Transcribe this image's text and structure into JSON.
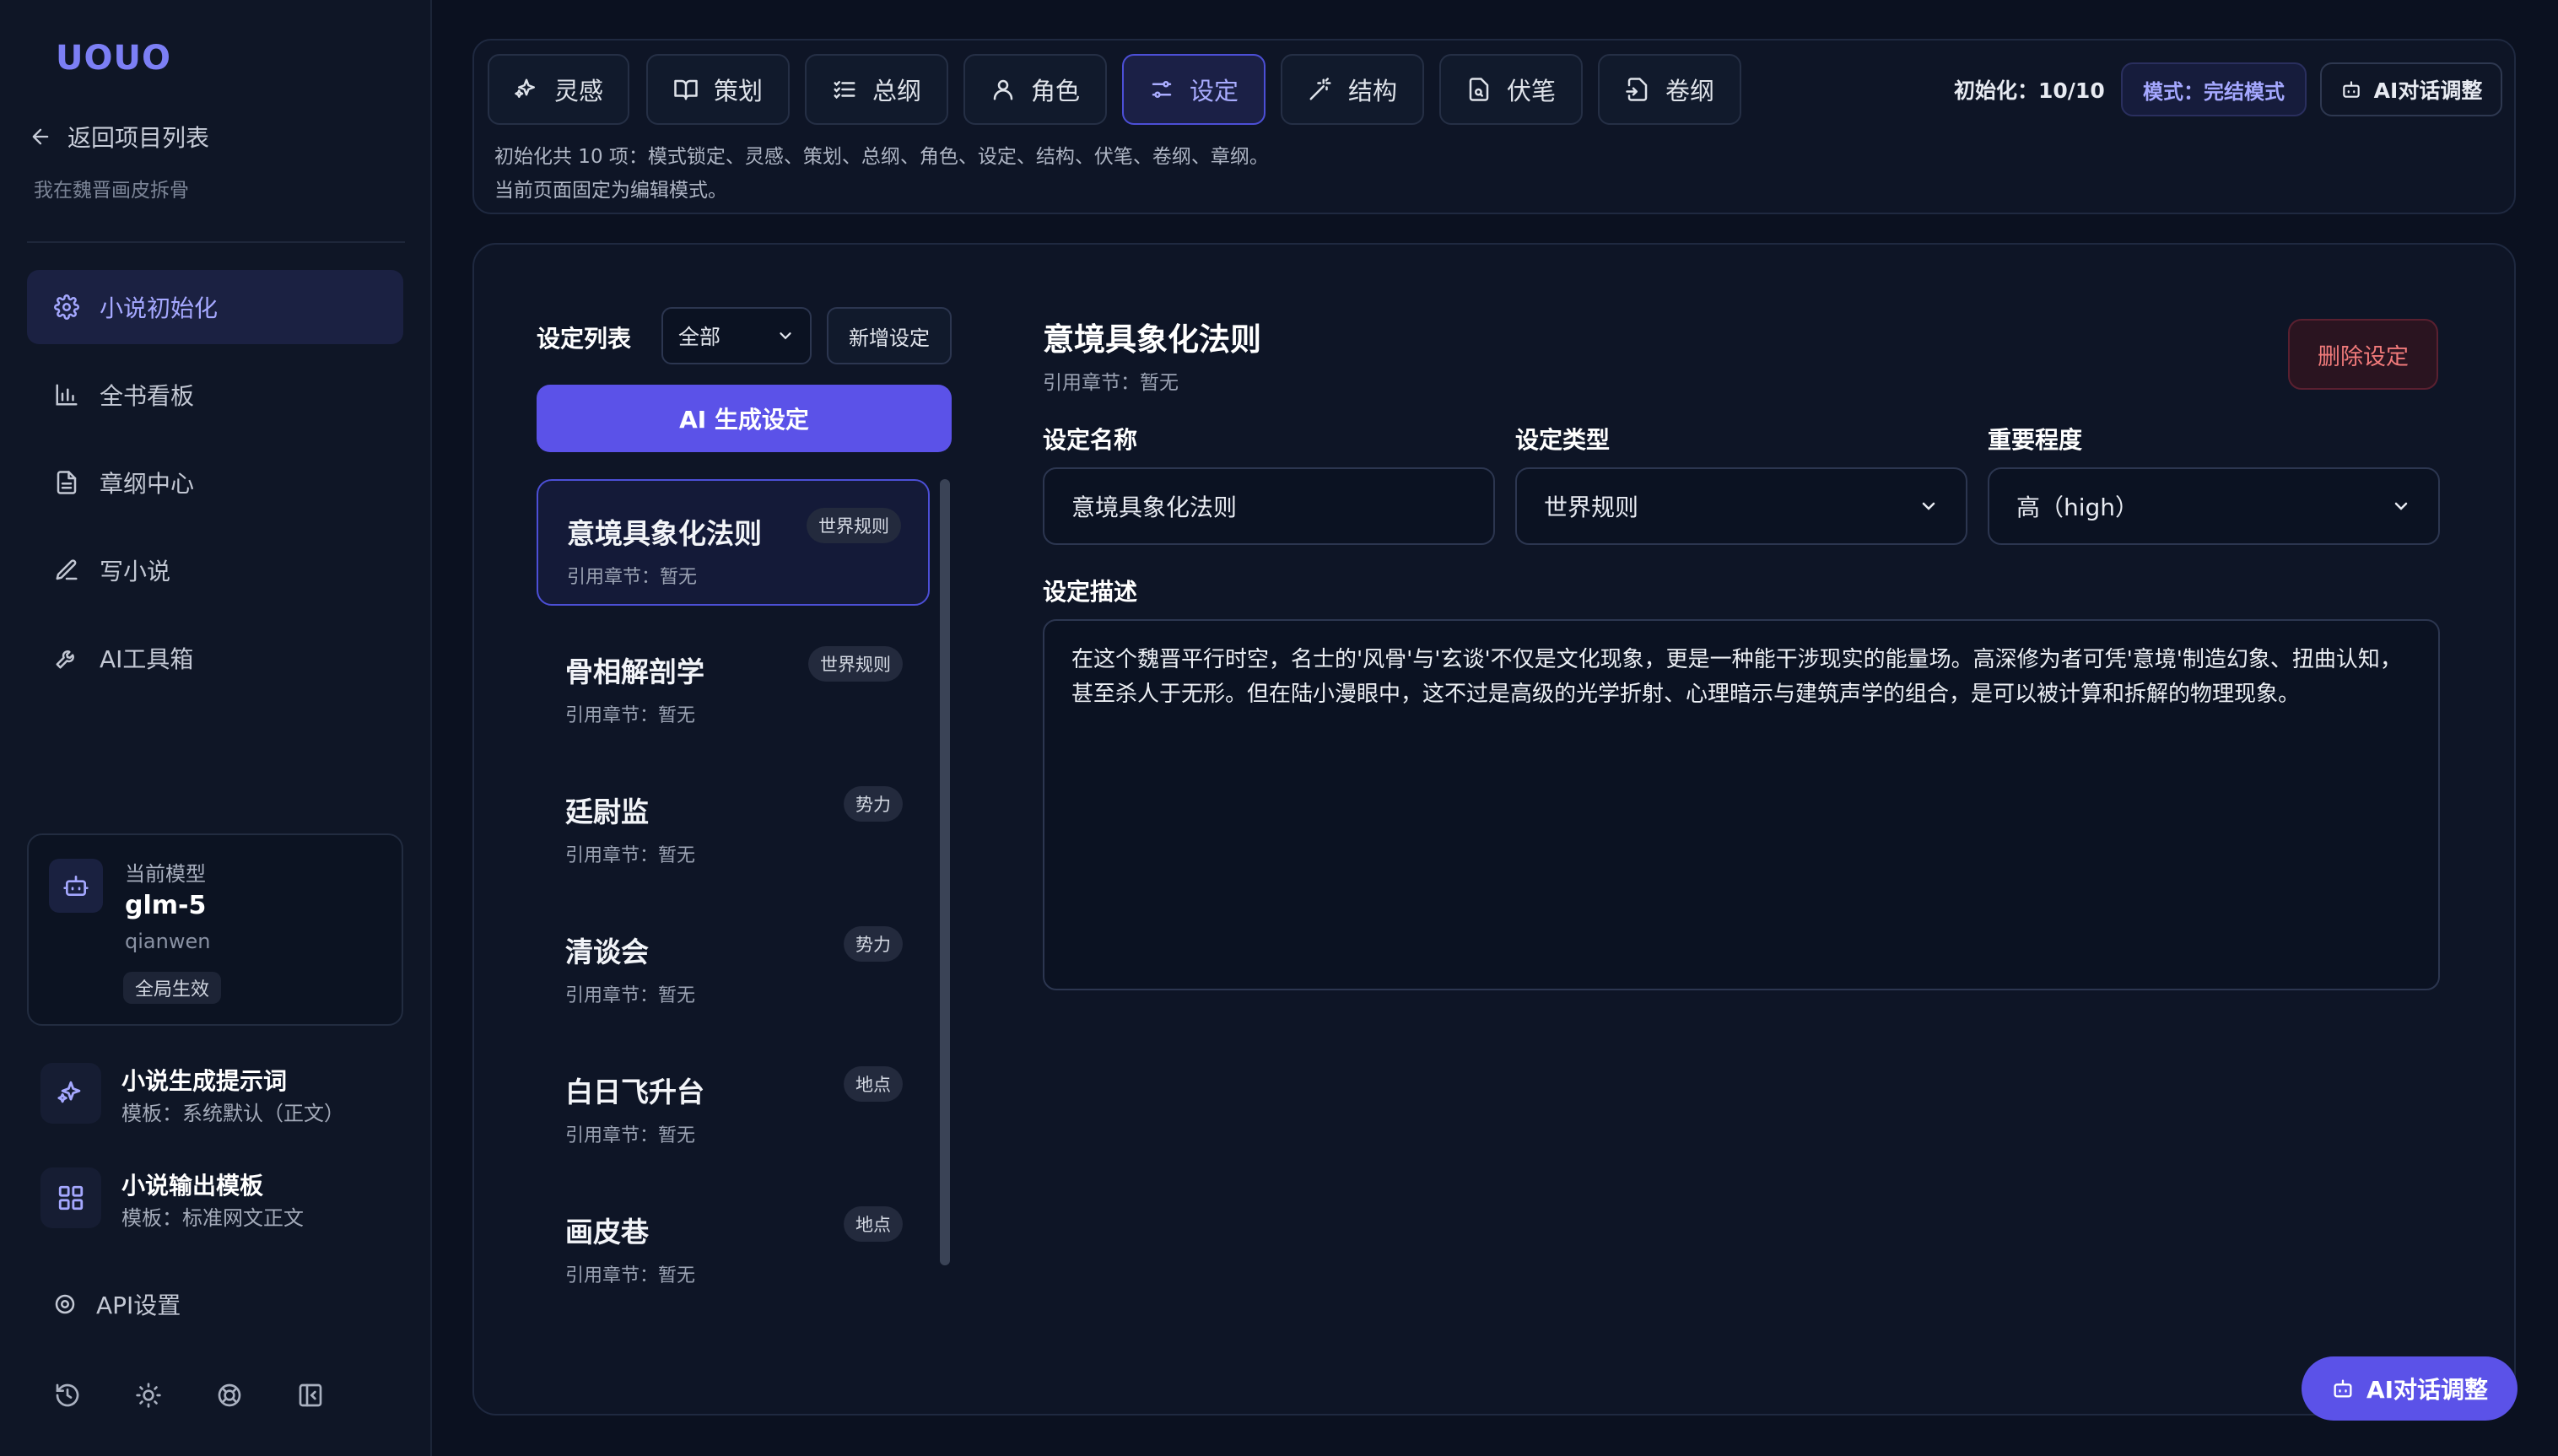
{
  "sidebar": {
    "logo": "UOUO",
    "back": "返回项目列表",
    "project": "我在魏晋画皮拆骨",
    "nav": [
      {
        "label": "小说初始化",
        "icon": "gear-icon",
        "active": true
      },
      {
        "label": "全书看板",
        "icon": "bar-chart-icon"
      },
      {
        "label": "章纲中心",
        "icon": "document-icon"
      },
      {
        "label": "写小说",
        "icon": "pen-icon"
      },
      {
        "label": "AI工具箱",
        "icon": "wrench-icon"
      }
    ],
    "model": {
      "label": "当前模型",
      "name": "glm-5",
      "provider": "qianwen",
      "badge": "全局生效"
    },
    "prompt": {
      "title": "小说生成提示词",
      "sub": "模板：系统默认（正文）"
    },
    "output": {
      "title": "小说输出模板",
      "sub": "模板：标准网文正文"
    },
    "api": "API设置"
  },
  "topbar": {
    "tabs": [
      {
        "label": "灵感",
        "icon": "sparkle-icon"
      },
      {
        "label": "策划",
        "icon": "book-icon"
      },
      {
        "label": "总纲",
        "icon": "list-icon"
      },
      {
        "label": "角色",
        "icon": "user-icon"
      },
      {
        "label": "设定",
        "icon": "sliders-icon",
        "active": true
      },
      {
        "label": "结构",
        "icon": "wand-icon"
      },
      {
        "label": "伏笔",
        "icon": "file-search-icon"
      },
      {
        "label": "卷纲",
        "icon": "file-import-icon"
      }
    ],
    "info1": "初始化共 10 项：模式锁定、灵感、策划、总纲、角色、设定、结构、伏笔、卷纲、章纲。",
    "info2": "当前页面固定为编辑模式。",
    "init_count": "初始化：10/10",
    "mode": "模式：完结模式",
    "ai_adjust": "AI对话调整"
  },
  "list": {
    "header": "设定列表",
    "filter": "全部",
    "add": "新增设定",
    "generate": "AI 生成设定",
    "items": [
      {
        "name": "意境具象化法则",
        "tag": "世界规则",
        "ref": "引用章节：暂无"
      },
      {
        "name": "骨相解剖学",
        "tag": "世界规则",
        "ref": "引用章节：暂无"
      },
      {
        "name": "廷尉监",
        "tag": "势力",
        "ref": "引用章节：暂无"
      },
      {
        "name": "清谈会",
        "tag": "势力",
        "ref": "引用章节：暂无"
      },
      {
        "name": "白日飞升台",
        "tag": "地点",
        "ref": "引用章节：暂无"
      },
      {
        "name": "画皮巷",
        "tag": "地点",
        "ref": "引用章节：暂无"
      }
    ]
  },
  "detail": {
    "title": "意境具象化法则",
    "ref": "引用章节：暂无",
    "delete": "删除设定",
    "name_label": "设定名称",
    "name_value": "意境具象化法则",
    "type_label": "设定类型",
    "type_value": "世界规则",
    "importance_label": "重要程度",
    "importance_value": "高（high）",
    "desc_label": "设定描述",
    "desc": "在这个魏晋平行时空，名士的'风骨'与'玄谈'不仅是文化现象，更是一种能干涉现实的能量场。高深修为者可凭'意境'制造幻象、扭曲认知，甚至杀人于无形。但在陆小漫眼中，这不过是高级的光学折射、心理暗示与建筑声学的组合，是可以被计算和拆解的物理现象。"
  },
  "fab": "AI对话调整",
  "colors": {
    "accent": "#5b52e8",
    "bg": "#0b1120",
    "panel": "#0e1526",
    "danger": "#f07a7a"
  }
}
